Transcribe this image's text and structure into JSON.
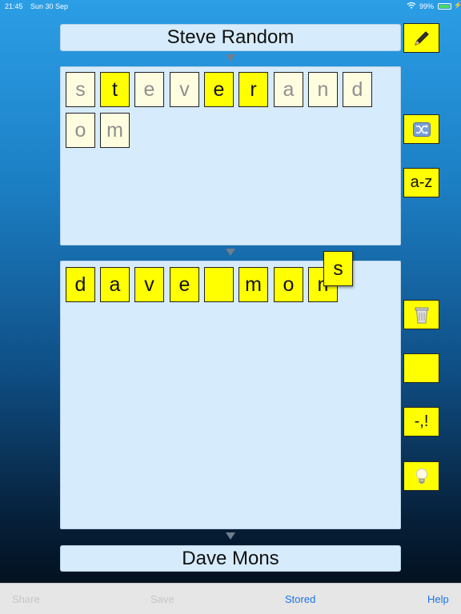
{
  "status_bar": {
    "time": "21:45",
    "date": "Sun 30 Sep",
    "battery": "99%",
    "wifi_icon": "wifi-icon",
    "battery_icon": "battery-icon"
  },
  "top_name": "Steve Random",
  "source_tiles": [
    {
      "letter": "s",
      "style": "pale"
    },
    {
      "letter": "t",
      "style": "yellow"
    },
    {
      "letter": "e",
      "style": "pale"
    },
    {
      "letter": "v",
      "style": "pale"
    },
    {
      "letter": "e",
      "style": "yellow"
    },
    {
      "letter": "r",
      "style": "yellow"
    },
    {
      "letter": "a",
      "style": "pale"
    },
    {
      "letter": "n",
      "style": "pale"
    },
    {
      "letter": "d",
      "style": "pale"
    },
    {
      "letter": "o",
      "style": "pale"
    },
    {
      "letter": "m",
      "style": "pale"
    }
  ],
  "answer_tiles": [
    {
      "letter": "d"
    },
    {
      "letter": "a"
    },
    {
      "letter": "v"
    },
    {
      "letter": "e"
    },
    {
      "letter": ""
    },
    {
      "letter": "m"
    },
    {
      "letter": "o"
    },
    {
      "letter": "n"
    }
  ],
  "dragging_tile": "s",
  "bottom_name": "Dave Mons",
  "side_buttons": {
    "edit_icon": "pencil-icon",
    "shuffle_icon": "shuffle-icon",
    "sort_label": "a-z",
    "clear_icon": "trash-icon",
    "space_label": "",
    "punctuation_label": "-,!",
    "hint_icon": "lightbulb-icon"
  },
  "bottom_bar": {
    "share": "Share",
    "save": "Save",
    "stored": "Stored",
    "help": "Help"
  },
  "colors": {
    "tile_active": "#ffff00",
    "tile_used": "#fffde0",
    "panel": "#d6ebfb",
    "link": "#1a73e8"
  }
}
